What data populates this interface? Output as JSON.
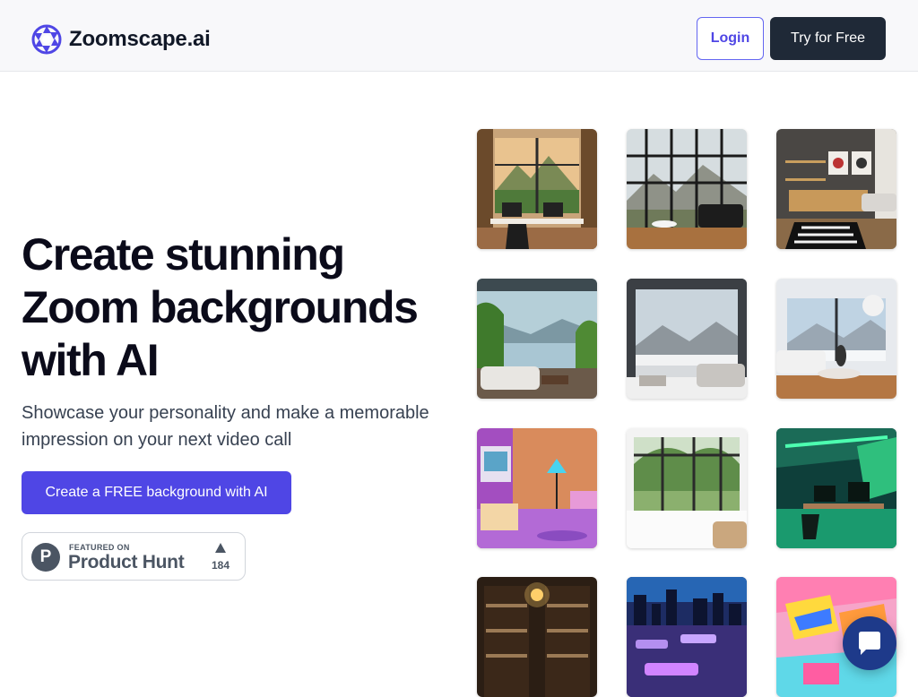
{
  "header": {
    "brand_name": "Zoomscape.ai",
    "login_label": "Login",
    "try_label": "Try for Free"
  },
  "hero": {
    "title": "Create stunning Zoom backgrounds with AI",
    "subtitle": "Showcase your personality and make a memorable impression on your next video call",
    "cta_label": "Create a FREE background with AI"
  },
  "product_hunt": {
    "featured_label": "FEATURED ON",
    "name": "Product Hunt",
    "upvotes": "184"
  },
  "gallery": {
    "tiles": [
      "library-office-mountain-view-icon",
      "windowed-living-room-mountain-icon",
      "modern-office-shelves-icon",
      "lakeside-lounge-icon",
      "snowy-mountain-lounge-icon",
      "snowy-view-living-room-icon",
      "retro-synthwave-room-icon",
      "glass-house-garden-icon",
      "neon-green-office-icon",
      "dark-library-lamp-icon",
      "night-city-rooftop-icon",
      "colorful-pop-art-room-icon"
    ]
  },
  "chat": {
    "icon": "chat-bubble-icon"
  },
  "colors": {
    "accent": "#4f46e5",
    "dark_button": "#1f2937",
    "header_bg": "#f8f8fa",
    "chat_bg": "#1e3a8a"
  }
}
